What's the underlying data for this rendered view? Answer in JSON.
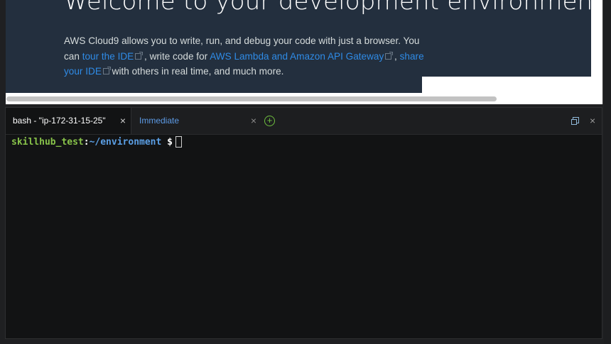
{
  "welcome": {
    "title": "Welcome to your development environment",
    "intro_1": "AWS Cloud9 allows you to write, run, and debug your code with just a browser. You can ",
    "link_tour": "tour the IDE",
    "intro_2": " , write code for ",
    "link_lambda": "AWS Lambda and Amazon API Gateway",
    "intro_3": " , ",
    "link_share": "share your IDE",
    "intro_4": " with others in real time, and much more."
  },
  "terminal": {
    "tabs": [
      {
        "label": "bash - \"ip-172-31-15-25\"",
        "close": "×",
        "active": true
      },
      {
        "label": "Immediate",
        "close": "×",
        "active": false
      }
    ],
    "add_tab": "+",
    "panel_close": "×",
    "prompt": {
      "user": "skillhub_test",
      "colon": ":",
      "path": "~/environment",
      "dollar": " $"
    }
  },
  "colors": {
    "welcome_bg": "#232f3e",
    "link": "#2f8be6",
    "prompt_user": "#88c34a",
    "prompt_path": "#5b9fe5",
    "add_tab": "#6fbf3f"
  },
  "icons": {
    "external_link": "external-link-icon",
    "add_tab": "plus-circle-icon",
    "restore": "restore-window-icon",
    "close": "close-icon"
  }
}
